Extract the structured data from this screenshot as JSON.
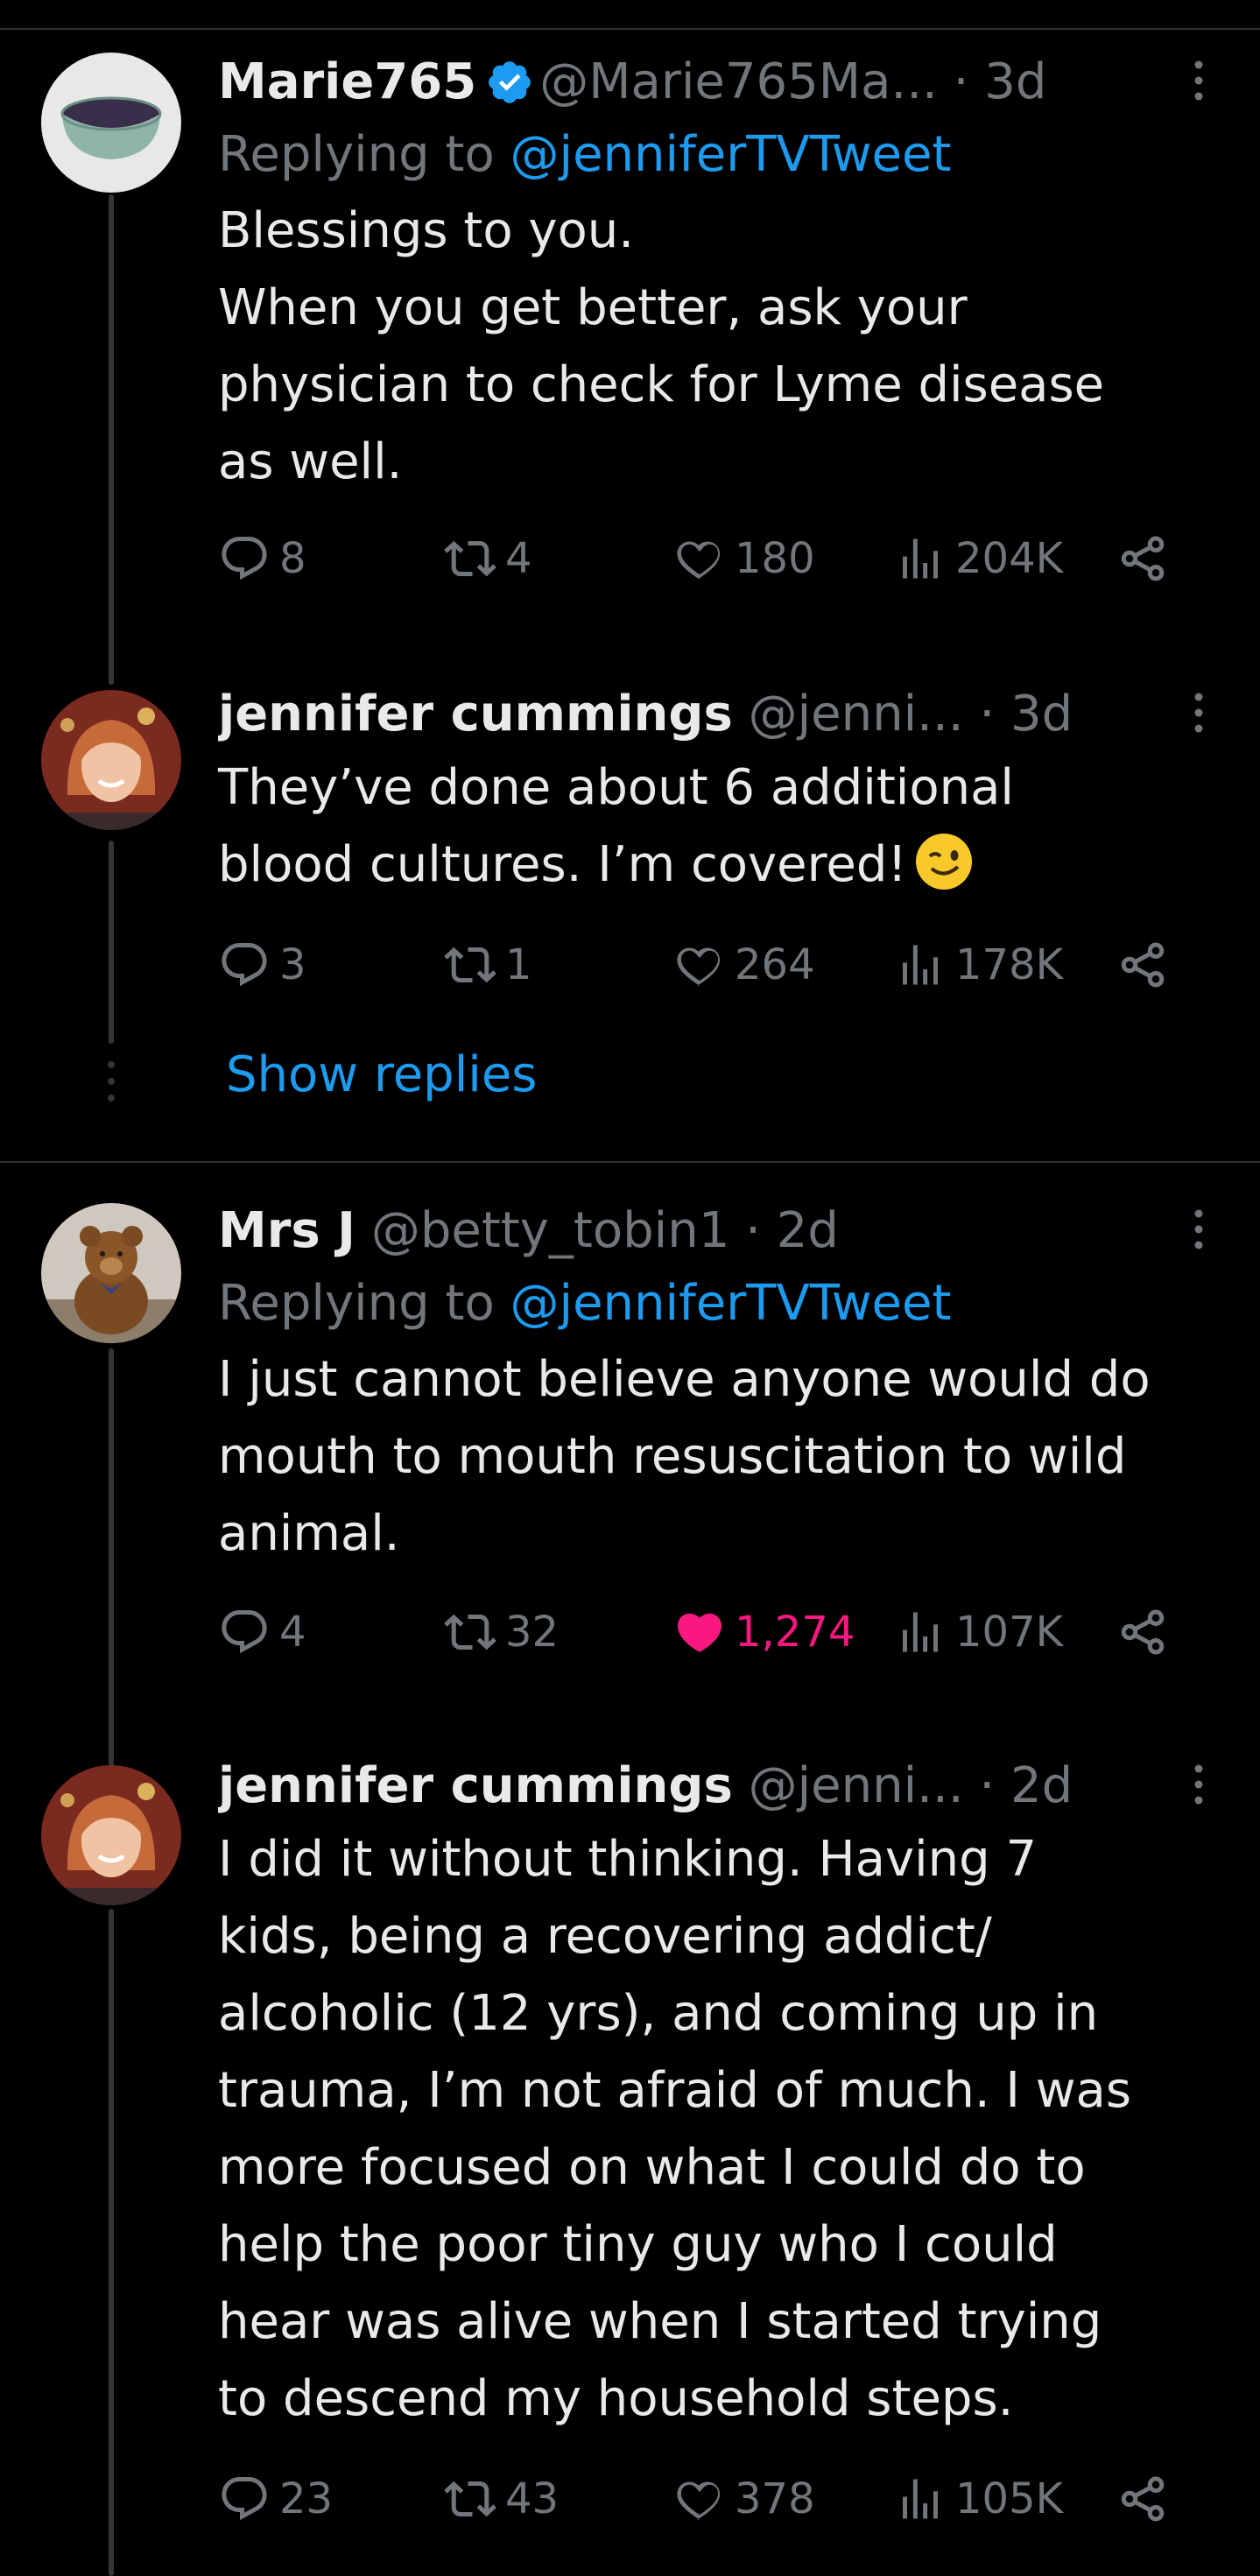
{
  "tweets": [
    {
      "name": "Marie765",
      "verified": true,
      "handle": "@Marie765Ma...",
      "time": "· 3d",
      "replying_label": "Replying to",
      "replying_handle": "@jenniferTVTweet",
      "text": "Blessings to you.\nWhen you get better, ask your\nphysician to check for Lyme disease\nas well.",
      "replies": "8",
      "reposts": "4",
      "likes": "180",
      "views": "204K",
      "liked": false
    },
    {
      "name": "jennifer cummings",
      "verified": false,
      "handle": "@jenni...",
      "time": "· 3d",
      "text": "They’ve done about 6 additional\nblood cultures.  I’m covered!",
      "emoji": "winking-face",
      "replies": "3",
      "reposts": "1",
      "likes": "264",
      "views": "178K",
      "liked": false
    },
    {
      "name": "Mrs J",
      "verified": false,
      "handle": "@betty_tobin1",
      "time": "· 2d",
      "replying_label": "Replying to",
      "replying_handle": "@jenniferTVTweet",
      "text": "I just cannot believe anyone would do\nmouth to mouth resuscitation to wild\nanimal.",
      "replies": "4",
      "reposts": "32",
      "likes": "1,274",
      "views": "107K",
      "liked": true
    },
    {
      "name": "jennifer cummings",
      "verified": false,
      "handle": "@jenni...",
      "time": "· 2d",
      "text": "I did it without thinking. Having 7\nkids, being a recovering addict/\nalcoholic (12 yrs), and coming up in\ntrauma, I’m not afraid of much. I was\nmore focused on what I could do to\nhelp the poor tiny guy who I could\nhear was alive when I started trying\nto descend my household steps.",
      "replies": "23",
      "reposts": "43",
      "likes": "378",
      "views": "105K",
      "liked": false
    }
  ],
  "show_replies_label": "Show replies",
  "colors": {
    "background": "#000000",
    "text": "#e7e9ea",
    "muted": "#71767b",
    "link": "#1d9bf0",
    "like": "#f91880",
    "divider": "#2f3336"
  }
}
